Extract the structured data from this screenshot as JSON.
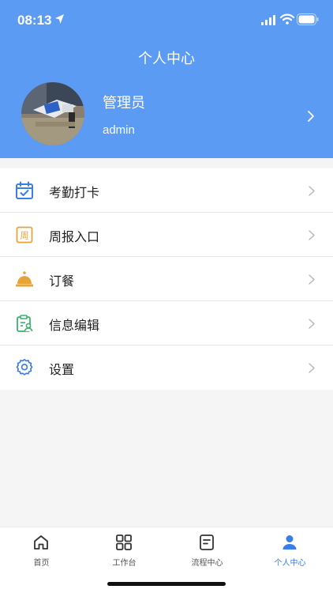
{
  "status": {
    "time": "08:13"
  },
  "header": {
    "title": "个人中心"
  },
  "profile": {
    "name": "管理员",
    "username": "admin"
  },
  "menu": [
    {
      "label": "考勤打卡",
      "icon": "calendar-check-icon",
      "color": "#3a7ee8"
    },
    {
      "label": "周报入口",
      "icon": "weekly-report-icon",
      "icon_text": "周",
      "color": "#e8a33a"
    },
    {
      "label": "订餐",
      "icon": "service-bell-icon",
      "color": "#e8a33a"
    },
    {
      "label": "信息编辑",
      "icon": "clipboard-user-icon",
      "color": "#37b36b"
    },
    {
      "label": "设置",
      "icon": "gear-icon",
      "color": "#3a7ee8"
    }
  ],
  "tabs": [
    {
      "label": "首页",
      "icon": "home-icon"
    },
    {
      "label": "工作台",
      "icon": "grid-icon"
    },
    {
      "label": "流程中心",
      "icon": "document-icon"
    },
    {
      "label": "个人中心",
      "icon": "user-icon",
      "active": true
    }
  ],
  "colors": {
    "header": "#5b9bf3",
    "accent": "#3a7ee8",
    "background": "#f5f5f5"
  }
}
